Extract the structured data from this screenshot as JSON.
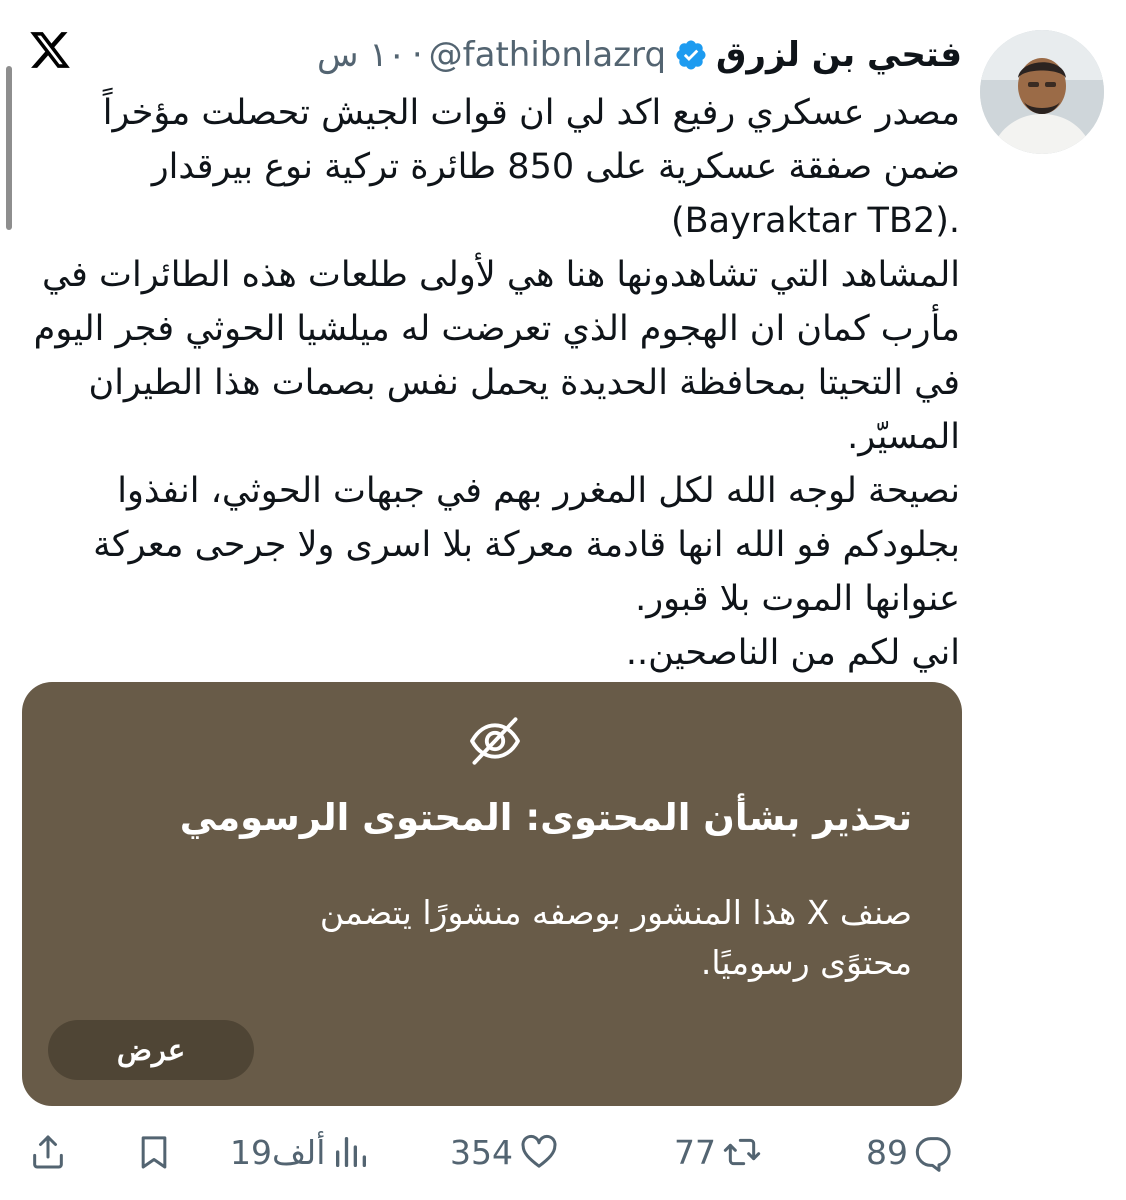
{
  "author": {
    "name": "فتحي بن لزرق",
    "handle": "@fathibnlazrq",
    "separator": "·",
    "time": "١٠ س"
  },
  "tweet": {
    "lines": [
      "مصدر عسكري رفيع اكد لي ان قوات الجيش تحصلت مؤخراً ضمن صفقة عسكرية على 850 طائرة تركية نوع بيرقدار",
      "(Bayraktar TB2).",
      "المشاهد التي تشاهدونها هنا هي لأولى طلعات هذه الطائرات في مأرب كمان ان الهجوم الذي تعرضت له ميلشيا الحوثي فجر اليوم في التحيتا بمحافظة الحديدة يحمل نفس بصمات هذا الطيران المسيّر.",
      "نصيحة لوجه الله لكل المغرر بهم في جبهات الحوثي، انفذوا بجلودكم فو الله انها قادمة معركة بلا اسرى ولا جرحى معركة عنوانها الموت بلا قبور.",
      "اني لكم من الناصحين.."
    ]
  },
  "media_warning": {
    "title": "تحذير بشأن المحتوى: المحتوى الرسومي",
    "body": "صنف X هذا المنشور بوصفه منشورًا يتضمن محتوًى رسوميًا.",
    "button_label": "عرض"
  },
  "actions": {
    "replies": "89",
    "reposts": "77",
    "likes": "354",
    "views": "19ألف"
  },
  "colors": {
    "card_background": "#685b48",
    "button_background": "#4f4535",
    "verified_badge": "#1d9bf0",
    "secondary_text": "#536471"
  }
}
